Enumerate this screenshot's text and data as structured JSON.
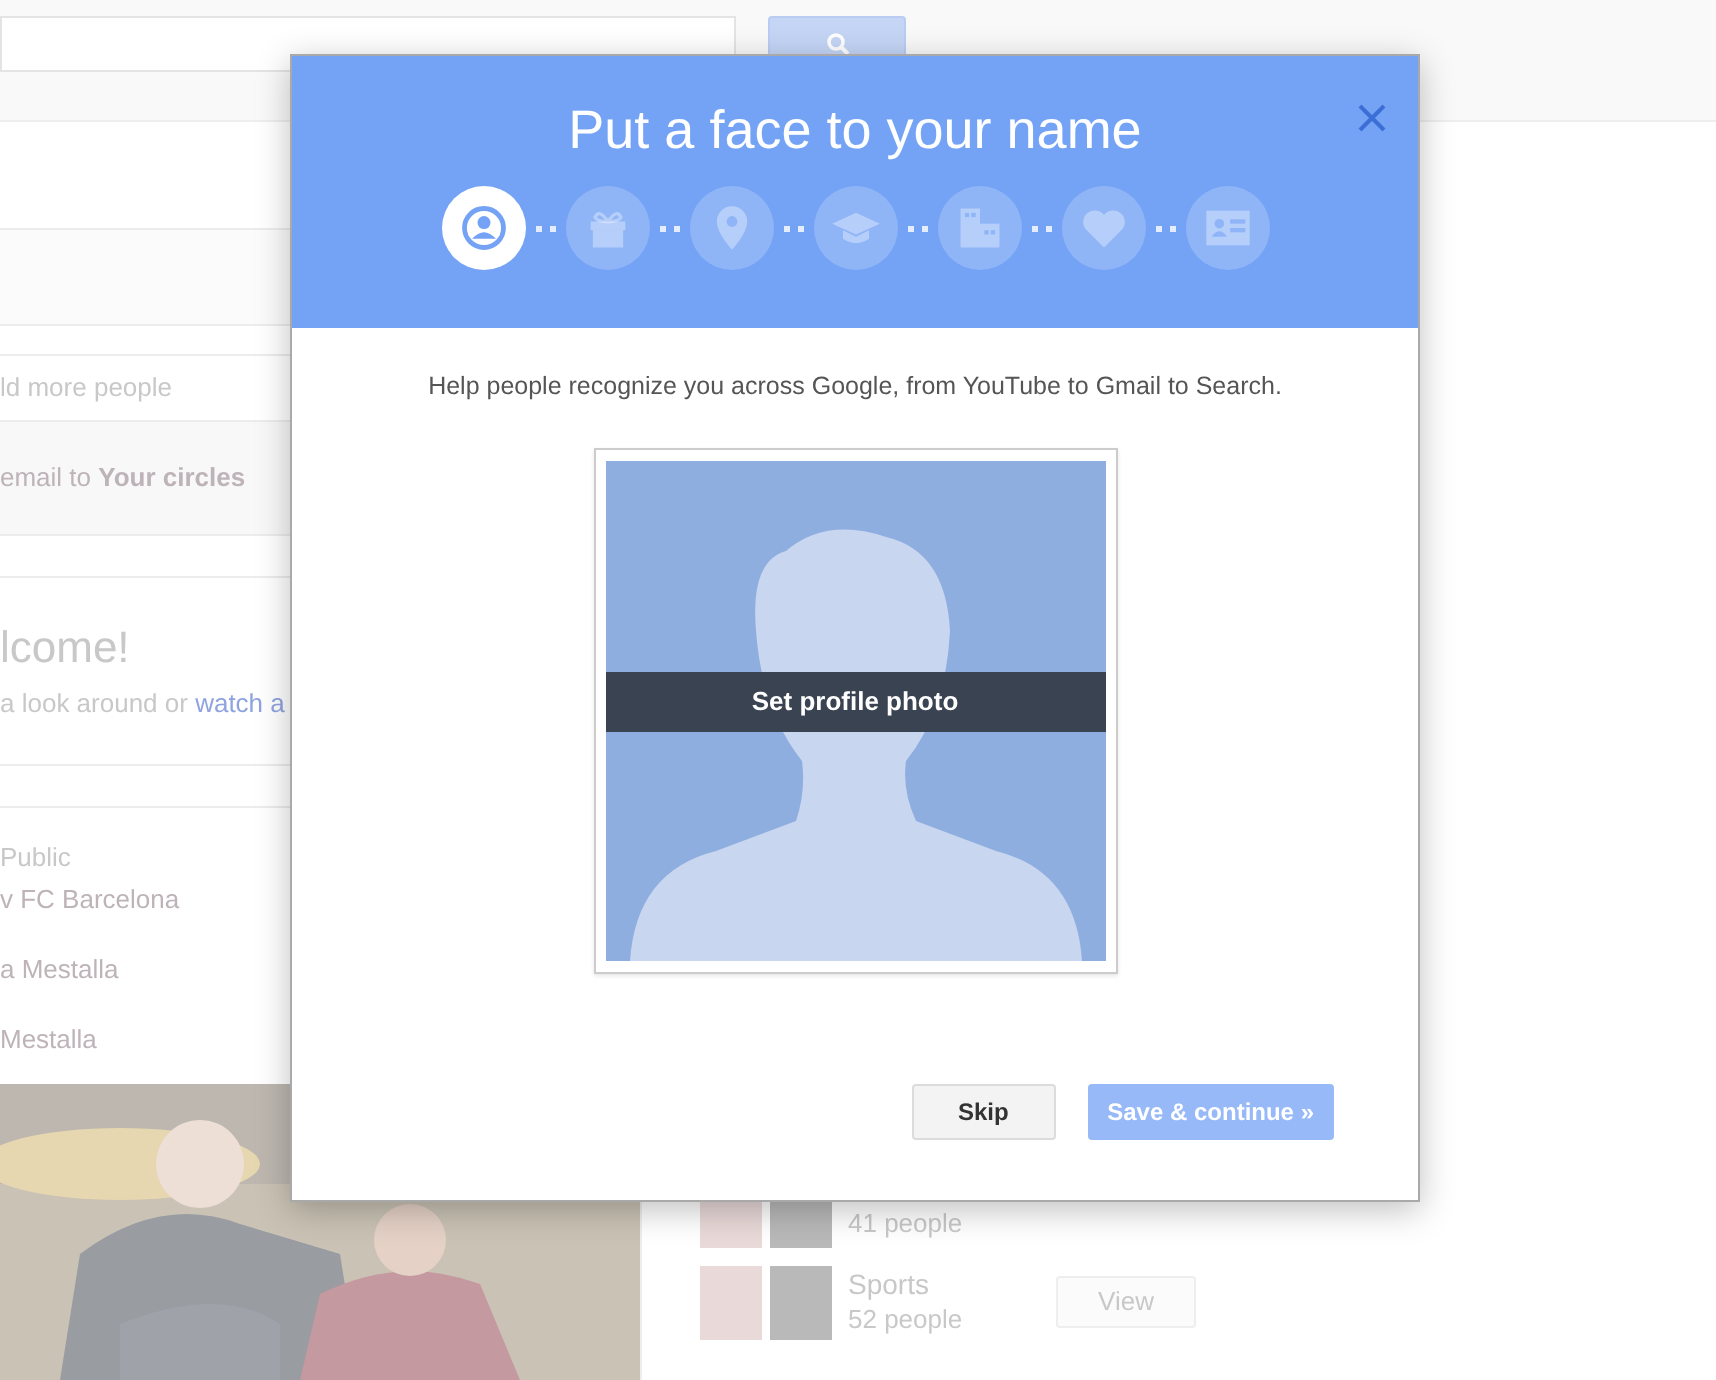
{
  "sidebar": {
    "add_people": "ld more people",
    "share_line": "email to **Your circles**",
    "welcome": {
      "title": "lcome!",
      "text": "a look around or ",
      "link": "watch a"
    },
    "post": {
      "audience": "Public",
      "lines": [
        "v FC Barcelona",
        "a Mestalla",
        "Mestalla"
      ]
    }
  },
  "communities": [
    {
      "members": "41 people"
    },
    {
      "name": "Sports",
      "members": "52 people",
      "button": "View"
    }
  ],
  "dialog": {
    "title": "Put a face to your name",
    "steps": [
      {
        "kind": "profile",
        "selected": true
      },
      {
        "kind": "gift",
        "selected": false
      },
      {
        "kind": "pin",
        "selected": false
      },
      {
        "kind": "school",
        "selected": false
      },
      {
        "kind": "building",
        "selected": false
      },
      {
        "kind": "heart",
        "selected": false
      },
      {
        "kind": "card",
        "selected": false
      }
    ],
    "intro": "Help people recognize you across Google, from YouTube to Gmail to Search.",
    "photo_label": "Set profile photo",
    "buttons": [
      {
        "label": "Skip",
        "kind": "secondary",
        "disabled": false
      },
      {
        "label": "Save & continue »",
        "kind": "primary",
        "disabled": true
      }
    ]
  }
}
